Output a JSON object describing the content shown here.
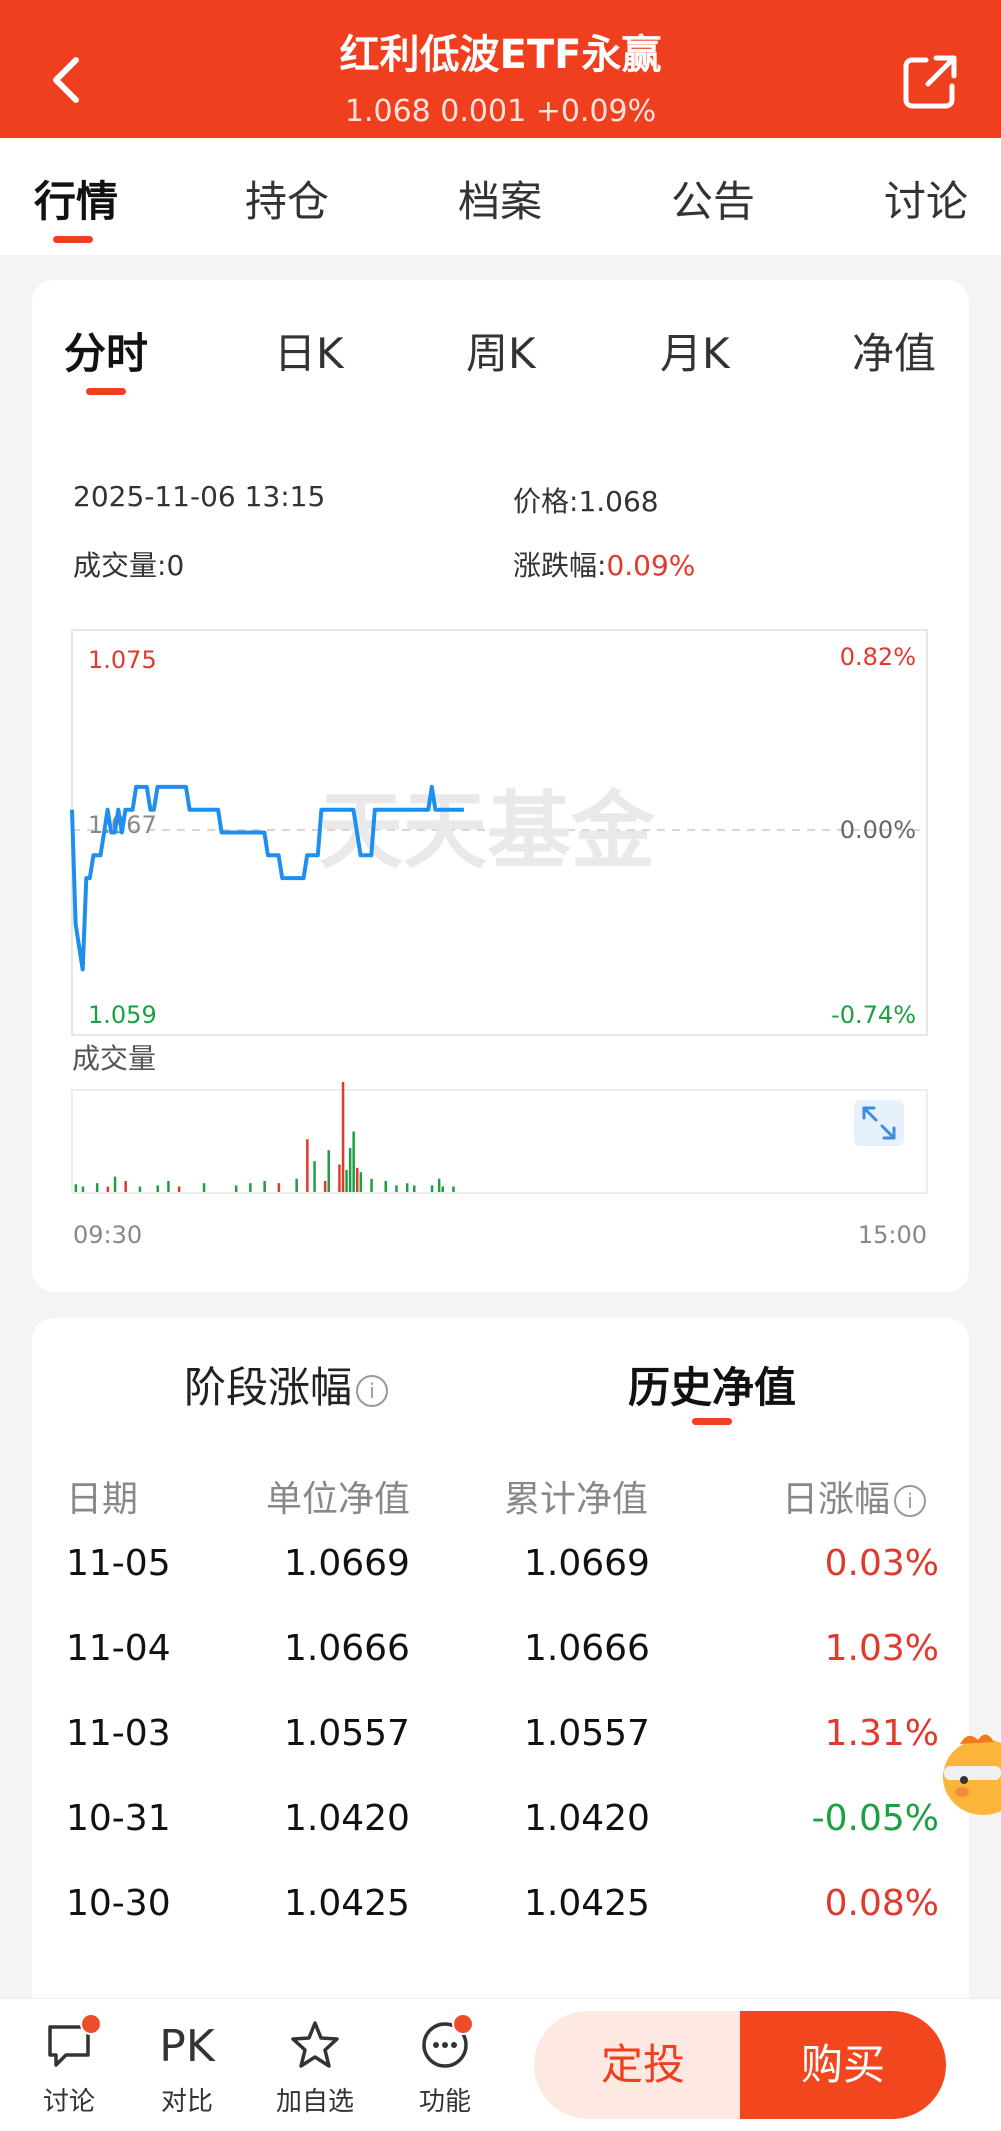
{
  "header": {
    "title": "红利低波ETF永赢",
    "subtitle": "1.068  0.001  +0.09%",
    "colors": {
      "brand": "#ef3f1f"
    }
  },
  "top_tabs": [
    "行情",
    "持仓",
    "档案",
    "公告",
    "讨论"
  ],
  "chart_tabs": [
    "分时",
    "日K",
    "周K",
    "月K",
    "净值"
  ],
  "info": {
    "datetime": "2025-11-06 13:15",
    "price_label": "价格:",
    "price": "1.068",
    "volume_label": "成交量:",
    "volume": "0",
    "change_label": "涨跌幅:",
    "change": "0.09%"
  },
  "chart_data": {
    "type": "line",
    "price_axis_labels": {
      "top": "1.075",
      "mid": "1.067",
      "bottom": "1.059"
    },
    "percent_axis_labels": {
      "top": "0.82%",
      "mid": "0.00%",
      "bottom": "-0.74%"
    },
    "ylim": [
      1.059,
      1.075
    ],
    "reference_price": 1.067,
    "watermark": "天天基金",
    "x_start_label": "09:30",
    "x_end_label": "15:00",
    "volume_title": "成交量",
    "price_series": [
      1.068,
      1.063,
      1.062,
      1.061,
      1.065,
      1.065,
      1.066,
      1.066,
      1.066,
      1.067,
      1.068,
      1.067,
      1.067,
      1.068,
      1.067,
      1.068,
      1.068,
      1.068,
      1.069,
      1.069,
      1.069,
      1.069,
      1.068,
      1.068,
      1.069,
      1.069,
      1.069,
      1.069,
      1.069,
      1.069,
      1.069,
      1.069,
      1.069,
      1.068,
      1.068,
      1.068,
      1.068,
      1.068,
      1.068,
      1.068,
      1.068,
      1.068,
      1.067,
      1.067,
      1.067,
      1.067,
      1.067,
      1.067,
      1.067,
      1.067,
      1.067,
      1.067,
      1.067,
      1.067,
      1.067,
      1.066,
      1.066,
      1.066,
      1.066,
      1.065,
      1.065,
      1.065,
      1.065,
      1.065,
      1.065,
      1.065,
      1.066,
      1.066,
      1.066,
      1.066,
      1.068,
      1.068,
      1.068,
      1.068,
      1.068,
      1.068,
      1.068,
      1.068,
      1.068,
      1.068,
      1.067,
      1.066,
      1.066,
      1.066,
      1.066,
      1.068,
      1.068,
      1.068,
      1.068,
      1.068,
      1.068,
      1.068,
      1.068,
      1.068,
      1.068,
      1.068,
      1.068,
      1.068,
      1.068,
      1.068,
      1.068,
      1.069,
      1.068,
      1.068,
      1.068,
      1.068,
      1.068,
      1.068,
      1.068,
      1.068,
      1.068
    ],
    "volume_bars": [
      {
        "i": 1,
        "v": 0.07,
        "c": "g"
      },
      {
        "i": 3,
        "v": 0.05,
        "c": "g"
      },
      {
        "i": 7,
        "v": 0.08,
        "c": "g"
      },
      {
        "i": 10,
        "v": 0.05,
        "c": "r"
      },
      {
        "i": 12,
        "v": 0.14,
        "c": "g"
      },
      {
        "i": 15,
        "v": 0.1,
        "c": "r"
      },
      {
        "i": 19,
        "v": 0.05,
        "c": "g"
      },
      {
        "i": 24,
        "v": 0.06,
        "c": "g"
      },
      {
        "i": 27,
        "v": 0.1,
        "c": "g"
      },
      {
        "i": 30,
        "v": 0.05,
        "c": "r"
      },
      {
        "i": 37,
        "v": 0.08,
        "c": "g"
      },
      {
        "i": 46,
        "v": 0.06,
        "c": "g"
      },
      {
        "i": 50,
        "v": 0.08,
        "c": "g"
      },
      {
        "i": 54,
        "v": 0.1,
        "c": "g"
      },
      {
        "i": 58,
        "v": 0.08,
        "c": "r"
      },
      {
        "i": 63,
        "v": 0.12,
        "c": "g"
      },
      {
        "i": 66,
        "v": 0.48,
        "c": "r"
      },
      {
        "i": 68,
        "v": 0.28,
        "c": "g"
      },
      {
        "i": 71,
        "v": 0.1,
        "c": "r"
      },
      {
        "i": 72,
        "v": 0.38,
        "c": "g"
      },
      {
        "i": 75,
        "v": 0.25,
        "c": "r"
      },
      {
        "i": 76,
        "v": 1.0,
        "c": "r"
      },
      {
        "i": 77,
        "v": 0.2,
        "c": "g"
      },
      {
        "i": 78,
        "v": 0.4,
        "c": "g"
      },
      {
        "i": 79,
        "v": 0.55,
        "c": "g"
      },
      {
        "i": 80,
        "v": 0.22,
        "c": "r"
      },
      {
        "i": 81,
        "v": 0.18,
        "c": "g"
      },
      {
        "i": 84,
        "v": 0.12,
        "c": "g"
      },
      {
        "i": 88,
        "v": 0.1,
        "c": "g"
      },
      {
        "i": 91,
        "v": 0.06,
        "c": "g"
      },
      {
        "i": 94,
        "v": 0.08,
        "c": "g"
      },
      {
        "i": 96,
        "v": 0.06,
        "c": "g"
      },
      {
        "i": 101,
        "v": 0.06,
        "c": "g"
      },
      {
        "i": 103,
        "v": 0.12,
        "c": "g"
      },
      {
        "i": 104,
        "v": 0.05,
        "c": "g"
      },
      {
        "i": 107,
        "v": 0.05,
        "c": "g"
      }
    ],
    "colors": {
      "line": "#1e8ef0",
      "up": "#e03a2f",
      "down": "#1aa142"
    }
  },
  "section_tabs": [
    "阶段涨幅",
    "历史净值"
  ],
  "history": {
    "columns": [
      "日期",
      "单位净值",
      "累计净值",
      "日涨幅"
    ],
    "rows": [
      {
        "date": "11-05",
        "unit": "1.0669",
        "accum": "1.0669",
        "change": "0.03%",
        "dir": "up"
      },
      {
        "date": "11-04",
        "unit": "1.0666",
        "accum": "1.0666",
        "change": "1.03%",
        "dir": "up"
      },
      {
        "date": "11-03",
        "unit": "1.0557",
        "accum": "1.0557",
        "change": "1.31%",
        "dir": "up"
      },
      {
        "date": "10-31",
        "unit": "1.0420",
        "accum": "1.0420",
        "change": "-0.05%",
        "dir": "down"
      },
      {
        "date": "10-30",
        "unit": "1.0425",
        "accum": "1.0425",
        "change": "0.08%",
        "dir": "up"
      }
    ]
  },
  "bottom_bar": {
    "discuss": "讨论",
    "pk_icon_text": "PK",
    "compare": "对比",
    "watchlist": "加自选",
    "functions": "功能",
    "dingtou": "定投",
    "buy": "购买"
  }
}
